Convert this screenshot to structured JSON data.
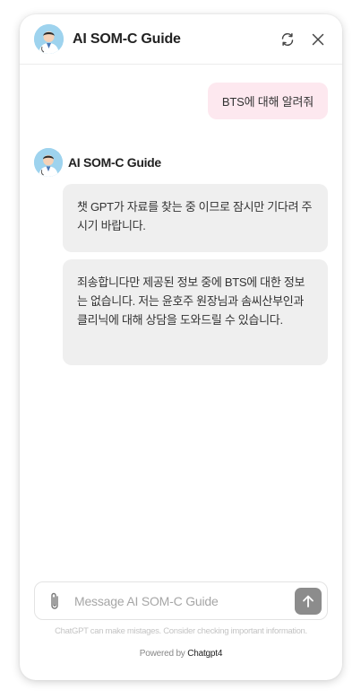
{
  "header": {
    "title": "AI SOM-C Guide",
    "refresh_icon": "refresh-icon",
    "close_icon": "close-icon"
  },
  "messages": {
    "user": [
      {
        "text": "BTS에 대해 알려줘"
      }
    ],
    "bot_name": "AI SOM-C Guide",
    "bot": [
      {
        "text": "챗 GPT가 자료를 찾는 중 이므로 잠시만 기다려 주시기 바랍니다."
      },
      {
        "text": "죄송합니다만 제공된 정보 중에 BTS에 대한 정보는 없습니다. 저는 윤호주 원장님과 솜씨산부인과 클리닉에 대해 상담을 도와드릴 수 있습니다."
      }
    ]
  },
  "composer": {
    "placeholder": "Message AI SOM-C Guide",
    "value": "",
    "attach_icon": "paperclip-icon",
    "send_icon": "arrow-up-icon"
  },
  "footer": {
    "disclaimer": "ChatGPT can make mistages. Consider checking important information.",
    "powered_prefix": "Powered by",
    "powered_brand": "Chatgpt4"
  },
  "colors": {
    "user_bubble": "#fde8ef",
    "bot_bubble": "#efefef",
    "send_button": "#8c8c8c",
    "avatar_bg": "#9ed3ee"
  }
}
